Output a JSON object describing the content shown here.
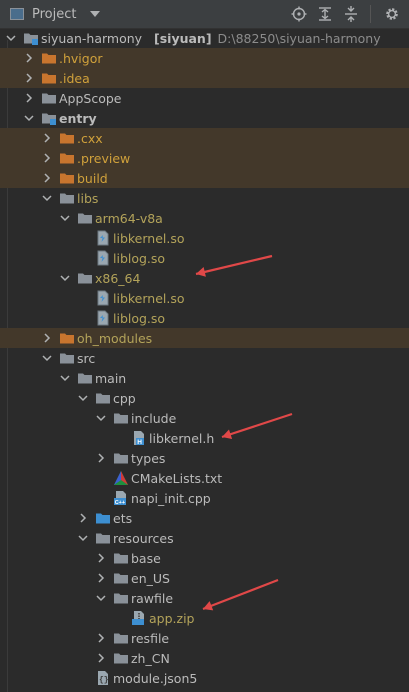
{
  "header": {
    "title": "Project",
    "tools": [
      "locate-icon",
      "expand-all-icon",
      "collapse-all-icon",
      "settings-icon"
    ]
  },
  "colors": {
    "background": "#2b2b2b",
    "header": "#3c3f41",
    "highlight": "#43382a",
    "excluded_text": "#d0a13b",
    "library_text": "#b3a35a",
    "arrow_annotation": "#e04848",
    "folder_orange": "#c8752e",
    "folder_gray": "#8a9199",
    "folder_blue": "#3d8fd1"
  },
  "tree": [
    {
      "depth": 0,
      "expanded": true,
      "icon": "module-folder-icon",
      "label": "siyuan-harmony",
      "tag": "[siyuan]",
      "path": "D:\\88250\\siyuan-harmony",
      "style": "norm",
      "highlight": false
    },
    {
      "depth": 1,
      "expanded": false,
      "icon": "orange-folder-icon",
      "label": ".hvigor",
      "style": "excl",
      "highlight": true
    },
    {
      "depth": 1,
      "expanded": false,
      "icon": "orange-folder-icon",
      "label": ".idea",
      "style": "excl",
      "highlight": true
    },
    {
      "depth": 1,
      "expanded": false,
      "icon": "gray-folder-icon",
      "label": "AppScope",
      "style": "norm",
      "highlight": false
    },
    {
      "depth": 1,
      "expanded": true,
      "icon": "module-folder-icon",
      "label": "entry",
      "style": "bold",
      "highlight": false
    },
    {
      "depth": 2,
      "expanded": false,
      "icon": "orange-folder-icon",
      "label": ".cxx",
      "style": "excl",
      "highlight": true
    },
    {
      "depth": 2,
      "expanded": false,
      "icon": "orange-folder-icon",
      "label": ".preview",
      "style": "excl",
      "highlight": true
    },
    {
      "depth": 2,
      "expanded": false,
      "icon": "orange-folder-icon",
      "label": "build",
      "style": "excl",
      "highlight": true
    },
    {
      "depth": 2,
      "expanded": true,
      "icon": "gray-folder-icon",
      "label": "libs",
      "style": "olive",
      "highlight": false
    },
    {
      "depth": 3,
      "expanded": true,
      "icon": "gray-folder-icon",
      "label": "arm64-v8a",
      "style": "olive",
      "highlight": false
    },
    {
      "depth": 4,
      "expanded": null,
      "icon": "so-file-icon",
      "label": "libkernel.so",
      "style": "olive",
      "highlight": false
    },
    {
      "depth": 4,
      "expanded": null,
      "icon": "so-file-icon",
      "label": "liblog.so",
      "style": "olive",
      "highlight": false
    },
    {
      "depth": 3,
      "expanded": true,
      "icon": "gray-folder-icon",
      "label": "x86_64",
      "style": "olive",
      "highlight": false
    },
    {
      "depth": 4,
      "expanded": null,
      "icon": "so-file-icon",
      "label": "libkernel.so",
      "style": "olive",
      "highlight": false
    },
    {
      "depth": 4,
      "expanded": null,
      "icon": "so-file-icon",
      "label": "liblog.so",
      "style": "olive",
      "highlight": false
    },
    {
      "depth": 2,
      "expanded": false,
      "icon": "orange-folder-icon",
      "label": "oh_modules",
      "style": "olive",
      "highlight": true
    },
    {
      "depth": 2,
      "expanded": true,
      "icon": "gray-folder-icon",
      "label": "src",
      "style": "norm",
      "highlight": false
    },
    {
      "depth": 3,
      "expanded": true,
      "icon": "gray-folder-icon",
      "label": "main",
      "style": "norm",
      "highlight": false
    },
    {
      "depth": 4,
      "expanded": true,
      "icon": "gray-folder-icon",
      "label": "cpp",
      "style": "norm",
      "highlight": false
    },
    {
      "depth": 5,
      "expanded": true,
      "icon": "gray-folder-icon",
      "label": "include",
      "style": "norm",
      "highlight": false
    },
    {
      "depth": 6,
      "expanded": null,
      "icon": "header-file-icon",
      "label": "libkernel.h",
      "style": "norm",
      "highlight": false
    },
    {
      "depth": 5,
      "expanded": false,
      "icon": "gray-folder-icon",
      "label": "types",
      "style": "norm",
      "highlight": false
    },
    {
      "depth": 5,
      "expanded": null,
      "icon": "cmake-icon",
      "label": "CMakeLists.txt",
      "style": "norm",
      "highlight": false
    },
    {
      "depth": 5,
      "expanded": null,
      "icon": "cpp-file-icon",
      "label": "napi_init.cpp",
      "style": "norm",
      "highlight": false
    },
    {
      "depth": 4,
      "expanded": false,
      "icon": "blue-folder-icon",
      "label": "ets",
      "style": "norm",
      "highlight": false
    },
    {
      "depth": 4,
      "expanded": true,
      "icon": "gray-folder-icon",
      "label": "resources",
      "style": "norm",
      "highlight": false
    },
    {
      "depth": 5,
      "expanded": false,
      "icon": "gray-folder-icon",
      "label": "base",
      "style": "norm",
      "highlight": false
    },
    {
      "depth": 5,
      "expanded": false,
      "icon": "gray-folder-icon",
      "label": "en_US",
      "style": "norm",
      "highlight": false
    },
    {
      "depth": 5,
      "expanded": true,
      "icon": "gray-folder-icon",
      "label": "rawfile",
      "style": "norm",
      "highlight": false
    },
    {
      "depth": 6,
      "expanded": null,
      "icon": "zip-file-icon",
      "label": "app.zip",
      "style": "olive",
      "highlight": false
    },
    {
      "depth": 5,
      "expanded": false,
      "icon": "gray-folder-icon",
      "label": "resfile",
      "style": "norm",
      "highlight": false
    },
    {
      "depth": 5,
      "expanded": false,
      "icon": "gray-folder-icon",
      "label": "zh_CN",
      "style": "norm",
      "highlight": false
    },
    {
      "depth": 4,
      "expanded": null,
      "icon": "json5-file-icon",
      "label": "module.json5",
      "style": "norm",
      "highlight": false
    }
  ],
  "annotations": [
    {
      "name": "arrow-to-x86_64"
    },
    {
      "name": "arrow-to-libkernel-h"
    },
    {
      "name": "arrow-to-app-zip"
    }
  ]
}
